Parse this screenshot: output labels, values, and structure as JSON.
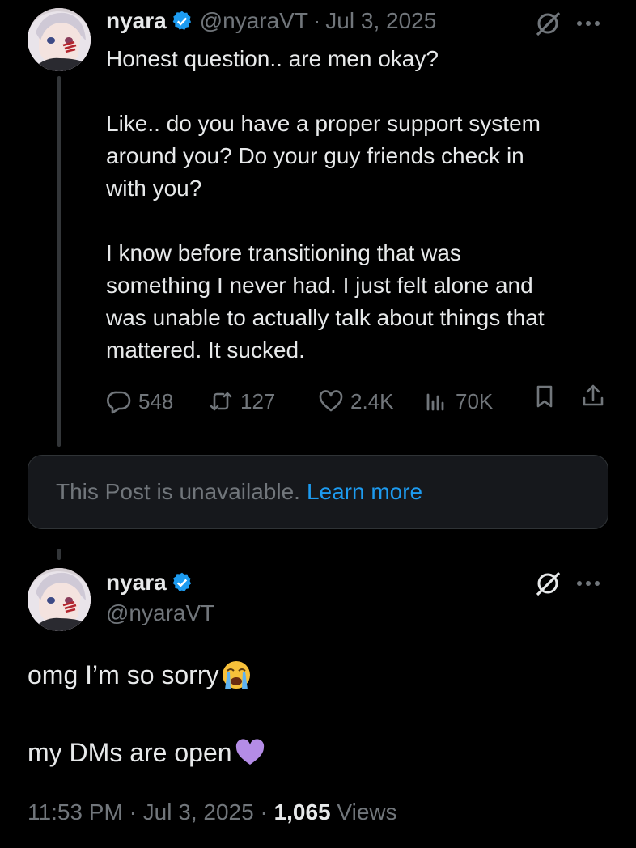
{
  "original_post": {
    "author_name": "nyara",
    "author_handle": "@nyaraVT",
    "separator": "·",
    "date": "Jul 3, 2025",
    "text_lines": {
      "line1": "Honest question.. are men okay?",
      "para2_line1": "Like.. do you have a proper support system",
      "para2_line2": "around you? Do your guy friends check in",
      "para2_line3": "with you?",
      "para3_line1": "I know before transitioning that was",
      "para3_line2": "something I never had. I just felt alone and",
      "para3_line3": "was unable to actually talk about things that",
      "para3_line4": "mattered. It sucked."
    },
    "actions": {
      "replies": "548",
      "reposts": "127",
      "likes": "2.4K",
      "views": "70K"
    },
    "icons": {
      "reply": "reply-bubble-icon",
      "repost": "repost-icon",
      "like": "heart-icon",
      "views": "views-bar-chart-icon",
      "bookmark": "bookmark-icon",
      "share": "share-icon",
      "grok": "grok-icon",
      "more": "more-dots-icon",
      "verified": "verified-badge-icon"
    }
  },
  "unavailable_notice": {
    "text": "This Post is unavailable.",
    "link": "Learn more"
  },
  "reply_post": {
    "author_name": "nyara",
    "author_handle": "@nyaraVT",
    "line1": "omg I’m so sorry",
    "line1_emoji": "loudly-crying-face-emoji",
    "line2": "my DMs are open",
    "line2_emoji": "purple-heart-emoji",
    "timestamp": "11:53 PM",
    "separator": "·",
    "date": "Jul 3, 2025",
    "views_count": "1,065",
    "views_label": "Views"
  },
  "colors": {
    "background": "#000000",
    "primary_text": "#e7e9ea",
    "secondary_text": "#71767b",
    "accent_blue": "#1d9bf0",
    "card_bg": "#16181c",
    "purple_heart": "#b48ce6"
  }
}
